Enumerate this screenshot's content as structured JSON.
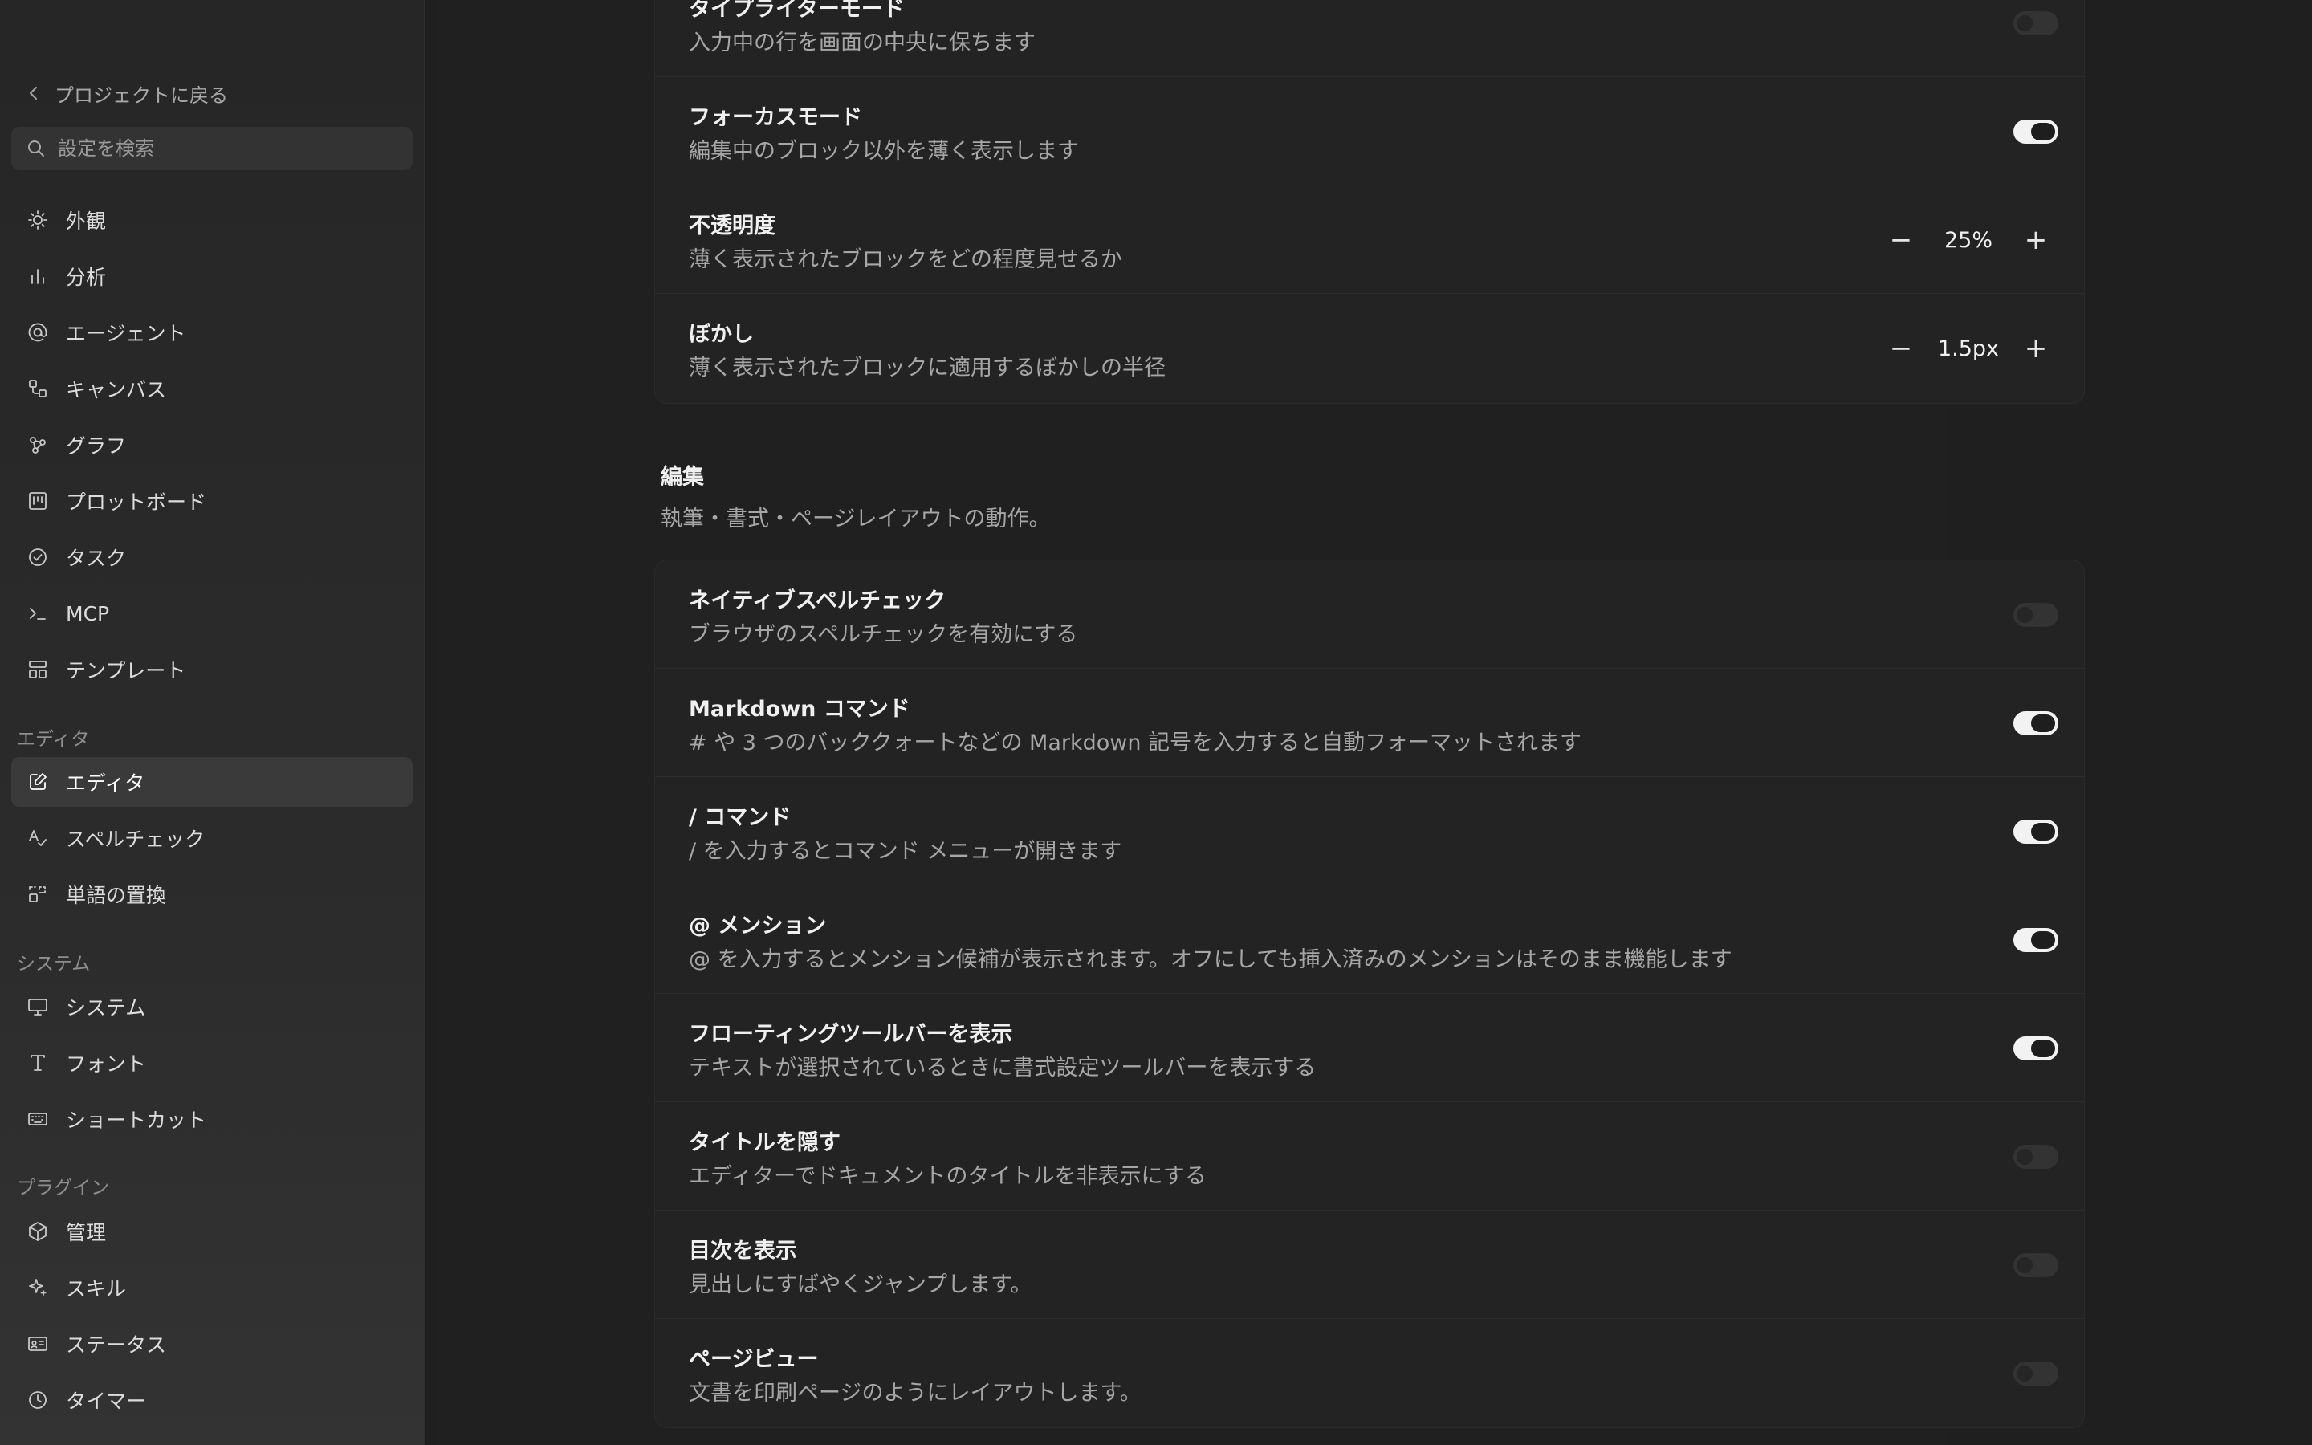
{
  "sidebar": {
    "back_label": "プロジェクトに戻る",
    "search_placeholder": "設定を検索",
    "items": [
      {
        "label": "外観",
        "icon": "sun-icon"
      },
      {
        "label": "分析",
        "icon": "bar-chart-icon"
      },
      {
        "label": "エージェント",
        "icon": "at-sign-icon"
      },
      {
        "label": "キャンバス",
        "icon": "canvas-icon"
      },
      {
        "label": "グラフ",
        "icon": "graph-icon"
      },
      {
        "label": "プロットボード",
        "icon": "kanban-icon"
      },
      {
        "label": "タスク",
        "icon": "check-circle-icon"
      },
      {
        "label": "MCP",
        "icon": "terminal-icon"
      },
      {
        "label": "テンプレート",
        "icon": "template-icon"
      }
    ],
    "section_editor": "エディタ",
    "editor_items": [
      {
        "label": "エディタ",
        "icon": "edit-icon",
        "active": true
      },
      {
        "label": "スペルチェック",
        "icon": "spellcheck-icon"
      },
      {
        "label": "単語の置換",
        "icon": "replace-icon"
      }
    ],
    "section_system": "システム",
    "system_items": [
      {
        "label": "システム",
        "icon": "monitor-icon"
      },
      {
        "label": "フォント",
        "icon": "type-icon"
      },
      {
        "label": "ショートカット",
        "icon": "keyboard-icon"
      }
    ],
    "section_plugins": "プラグイン",
    "plugin_items": [
      {
        "label": "管理",
        "icon": "package-icon"
      },
      {
        "label": "スキル",
        "icon": "sparkle-icon"
      },
      {
        "label": "ステータス",
        "icon": "id-card-icon"
      },
      {
        "label": "タイマー",
        "icon": "clock-icon"
      }
    ]
  },
  "card1": {
    "typewriter": {
      "title": "タイプライターモード",
      "desc": "入力中の行を画面の中央に保ちます",
      "enabled": false
    },
    "focus": {
      "title": "フォーカスモード",
      "desc": "編集中のブロック以外を薄く表示します",
      "enabled": true
    },
    "opacity": {
      "title": "不透明度",
      "desc": "薄く表示されたブロックをどの程度見せるか",
      "value": "25%"
    },
    "blur": {
      "title": "ぼかし",
      "desc": "薄く表示されたブロックに適用するぼかしの半径",
      "value": "1.5px"
    }
  },
  "editing_section": {
    "title": "編集",
    "desc": "執筆・書式・ページレイアウトの動作。"
  },
  "card2": {
    "rows": [
      {
        "title": "ネイティブスペルチェック",
        "desc": "ブラウザのスペルチェックを有効にする",
        "enabled": false
      },
      {
        "title": "Markdown コマンド",
        "desc": "# や 3 つのバッククォートなどの Markdown 記号を入力すると自動フォーマットされます",
        "enabled": true
      },
      {
        "title": "/ コマンド",
        "desc": "/ を入力するとコマンド メニューが開きます",
        "enabled": true
      },
      {
        "title": "@ メンション",
        "desc": "@ を入力するとメンション候補が表示されます。オフにしても挿入済みのメンションはそのまま機能します",
        "enabled": true
      },
      {
        "title": "フローティングツールバーを表示",
        "desc": "テキストが選択されているときに書式設定ツールバーを表示する",
        "enabled": true
      },
      {
        "title": "タイトルを隠す",
        "desc": "エディターでドキュメントのタイトルを非表示にする",
        "enabled": false
      },
      {
        "title": "目次を表示",
        "desc": "見出しにすばやくジャンプします。",
        "enabled": false
      },
      {
        "title": "ページビュー",
        "desc": "文書を印刷ページのようにレイアウトします。",
        "enabled": false
      }
    ]
  },
  "stepper_symbols": {
    "minus": "−",
    "plus": "+"
  }
}
